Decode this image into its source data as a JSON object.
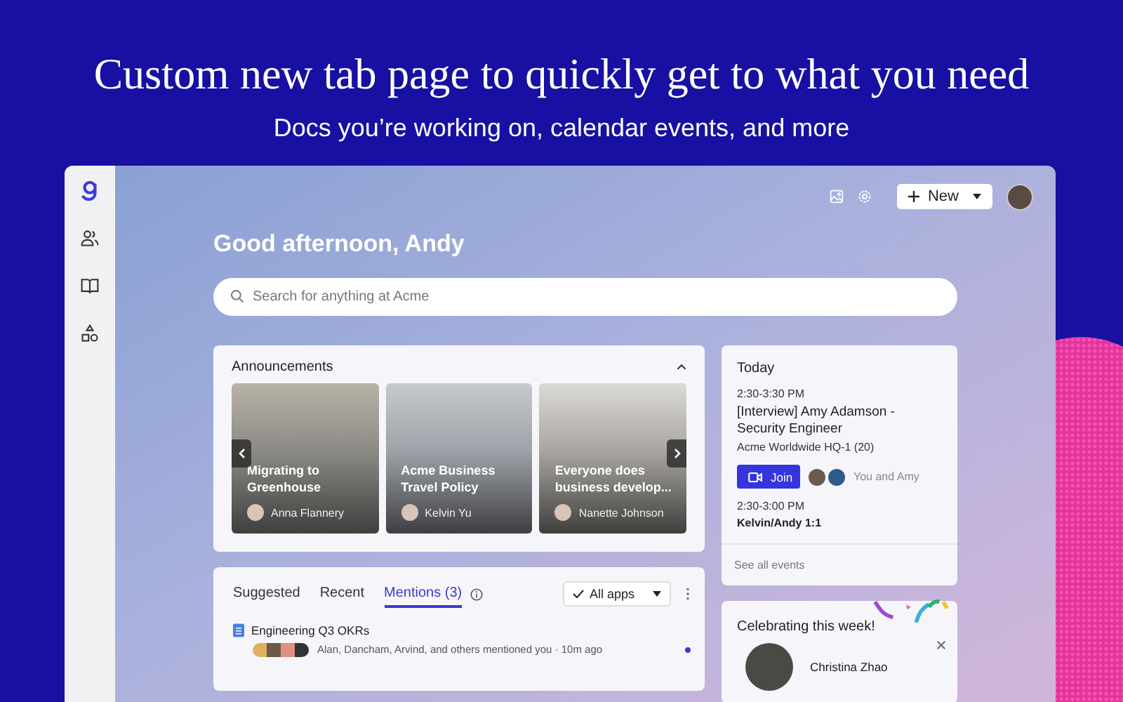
{
  "hero": {
    "title": "Custom new tab page to quickly get to what you need",
    "subtitle": "Docs you’re working on, calendar events, and more"
  },
  "topbar": {
    "new_button": "New"
  },
  "greeting": "Good afternoon, Andy",
  "search": {
    "placeholder": "Search for anything at Acme"
  },
  "announcements": {
    "title": "Announcements",
    "items": [
      {
        "title": "Migrating to Greenhouse",
        "author": "Anna Flannery"
      },
      {
        "title": "Acme Business Travel Policy",
        "author": "Kelvin Yu"
      },
      {
        "title": "Everyone does business develop...",
        "author": "Nanette Johnson"
      }
    ]
  },
  "calendar": {
    "heading": "Today",
    "events": [
      {
        "time": "2:30-3:30 PM",
        "title": "[Interview] Amy Adamson - Security Engineer",
        "location": "Acme Worldwide HQ-1 (20)",
        "join": "Join",
        "attendees": "You and Amy"
      },
      {
        "time": "2:30-3:00 PM",
        "title": "Kelvin/Andy 1:1"
      }
    ],
    "footer": "See all events"
  },
  "feed": {
    "tabs": [
      {
        "label": "Suggested",
        "selected": false
      },
      {
        "label": "Recent",
        "selected": false
      },
      {
        "label": "Mentions (3)",
        "selected": true
      }
    ],
    "filter": "All apps",
    "items": [
      {
        "title": "Engineering Q3 OKRs",
        "meta": "Alan, Dancham, Arvind, and others mentioned you · 10m ago",
        "unread": true
      }
    ]
  },
  "celebration": {
    "title": "Celebrating this week!",
    "name": "Christina Zhao"
  }
}
